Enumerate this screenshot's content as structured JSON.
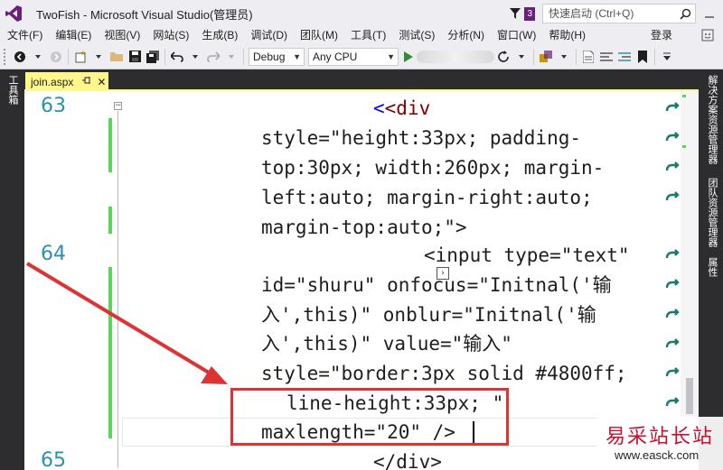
{
  "window": {
    "title": "TwoFish - Microsoft Visual Studio(管理员)",
    "notification_count": "3",
    "quick_launch_placeholder": "快速启动 (Ctrl+Q)"
  },
  "menu": {
    "items": [
      "文件(F)",
      "编辑(E)",
      "视图(V)",
      "网站(S)",
      "生成(B)",
      "调试(D)",
      "团队(M)",
      "工具(T)",
      "测试(S)",
      "分析(N)",
      "窗口(W)",
      "帮助(H)"
    ],
    "login": "登录"
  },
  "toolbar": {
    "config_value": "Debug",
    "platform_value": "Any CPU"
  },
  "side_tabs": {
    "left": "工具箱",
    "right": [
      "解决方案资源管理器",
      "团队资源管理器",
      "属性"
    ]
  },
  "document_tab": {
    "label": "join.aspx",
    "pin_icon": "pin-icon",
    "close_icon": "close-icon"
  },
  "editor": {
    "line_numbers": [
      "63",
      "64",
      "65"
    ],
    "code_lines": [
      "<div",
      "style=\"height:33px; padding-",
      "top:30px; width:260px; margin-",
      "left:auto; margin-right:auto;",
      "margin-top:auto;\">",
      "<input type=\"text\"",
      "id=\"shuru\" onfocus=\"Initnal('输",
      "入',this)\" onblur=\"Initnal('输",
      "入',this)\" value=\"输入\"",
      "style=\"border:3px solid #4800ff;",
      "line-height:33px; \"",
      "maxlength=\"20\" />",
      "</div>"
    ]
  },
  "annotation": {
    "color": "#dd3333"
  },
  "watermark": {
    "text": "易采站长站",
    "url": "www.easck.com"
  },
  "colors": {
    "accent": "#68217a",
    "tab_active": "#fff78c",
    "tag": "#800000",
    "attribute": "#ff0000",
    "value": "#0000ff",
    "line_number": "#2b91af",
    "change_bar": "#57d957"
  }
}
